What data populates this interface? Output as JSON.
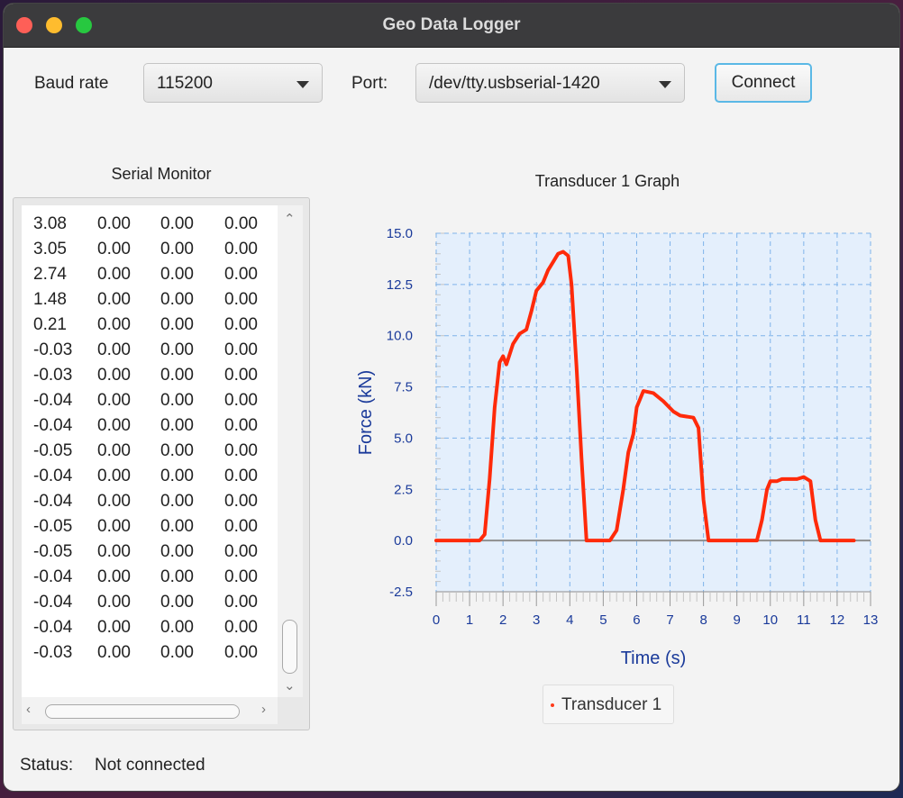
{
  "window": {
    "title": "Geo Data Logger"
  },
  "toolbar": {
    "baud_label": "Baud rate",
    "baud_value": "115200",
    "port_label": "Port:",
    "port_value": "/dev/tty.usbserial-1420",
    "connect_label": "Connect"
  },
  "monitor": {
    "title": "Serial Monitor",
    "rows": [
      [
        "3.08",
        "0.00",
        "0.00",
        "0.00"
      ],
      [
        "3.05",
        "0.00",
        "0.00",
        "0.00"
      ],
      [
        "2.74",
        "0.00",
        "0.00",
        "0.00"
      ],
      [
        "1.48",
        "0.00",
        "0.00",
        "0.00"
      ],
      [
        "0.21",
        "0.00",
        "0.00",
        "0.00"
      ],
      [
        "-0.03",
        "0.00",
        "0.00",
        "0.00"
      ],
      [
        "-0.03",
        "0.00",
        "0.00",
        "0.00"
      ],
      [
        "-0.04",
        "0.00",
        "0.00",
        "0.00"
      ],
      [
        "-0.04",
        "0.00",
        "0.00",
        "0.00"
      ],
      [
        "-0.05",
        "0.00",
        "0.00",
        "0.00"
      ],
      [
        "-0.04",
        "0.00",
        "0.00",
        "0.00"
      ],
      [
        "-0.04",
        "0.00",
        "0.00",
        "0.00"
      ],
      [
        "-0.05",
        "0.00",
        "0.00",
        "0.00"
      ],
      [
        "-0.05",
        "0.00",
        "0.00",
        "0.00"
      ],
      [
        "-0.04",
        "0.00",
        "0.00",
        "0.00"
      ],
      [
        "-0.04",
        "0.00",
        "0.00",
        "0.00"
      ],
      [
        "-0.04",
        "0.00",
        "0.00",
        "0.00"
      ],
      [
        "-0.03",
        "0.00",
        "0.00",
        "0.00"
      ]
    ]
  },
  "chart_data": {
    "type": "line",
    "title": "Transducer 1 Graph",
    "xlabel": "Time (s)",
    "ylabel": "Force (kN)",
    "xlim": [
      0,
      13
    ],
    "ylim": [
      -2.5,
      15.0
    ],
    "xticks": [
      "0",
      "1",
      "2",
      "3",
      "4",
      "5",
      "6",
      "7",
      "8",
      "9",
      "10",
      "11",
      "12",
      "13"
    ],
    "yticks": [
      "15.0",
      "12.5",
      "10.0",
      "7.5",
      "5.0",
      "2.5",
      "0.0",
      "-2.5"
    ],
    "grid": true,
    "legend": "bottom",
    "series": [
      {
        "name": "Transducer 1",
        "color": "#ff2a0a",
        "points": [
          [
            0,
            0.0
          ],
          [
            1.3,
            0.0
          ],
          [
            1.45,
            0.3
          ],
          [
            1.6,
            3.0
          ],
          [
            1.75,
            6.5
          ],
          [
            1.9,
            8.7
          ],
          [
            2.0,
            9.0
          ],
          [
            2.1,
            8.6
          ],
          [
            2.3,
            9.6
          ],
          [
            2.5,
            10.1
          ],
          [
            2.7,
            10.3
          ],
          [
            2.85,
            11.2
          ],
          [
            3.0,
            12.2
          ],
          [
            3.2,
            12.6
          ],
          [
            3.35,
            13.2
          ],
          [
            3.5,
            13.6
          ],
          [
            3.65,
            14.0
          ],
          [
            3.8,
            14.1
          ],
          [
            3.95,
            13.9
          ],
          [
            4.05,
            12.5
          ],
          [
            4.2,
            8.5
          ],
          [
            4.35,
            4.0
          ],
          [
            4.5,
            0.0
          ],
          [
            5.2,
            0.0
          ],
          [
            5.4,
            0.5
          ],
          [
            5.6,
            2.5
          ],
          [
            5.75,
            4.3
          ],
          [
            5.9,
            5.2
          ],
          [
            6.0,
            6.5
          ],
          [
            6.2,
            7.3
          ],
          [
            6.5,
            7.2
          ],
          [
            6.8,
            6.8
          ],
          [
            7.1,
            6.3
          ],
          [
            7.3,
            6.1
          ],
          [
            7.7,
            6.0
          ],
          [
            7.85,
            5.5
          ],
          [
            8.0,
            2.0
          ],
          [
            8.15,
            0.0
          ],
          [
            9.6,
            0.0
          ],
          [
            9.75,
            1.0
          ],
          [
            9.9,
            2.5
          ],
          [
            10.0,
            2.9
          ],
          [
            10.2,
            2.9
          ],
          [
            10.35,
            3.0
          ],
          [
            10.8,
            3.0
          ],
          [
            11.0,
            3.1
          ],
          [
            11.2,
            2.9
          ],
          [
            11.35,
            1.0
          ],
          [
            11.5,
            0.0
          ],
          [
            12.5,
            0.0
          ]
        ]
      }
    ]
  },
  "status": {
    "label": "Status:",
    "value": "Not connected"
  }
}
